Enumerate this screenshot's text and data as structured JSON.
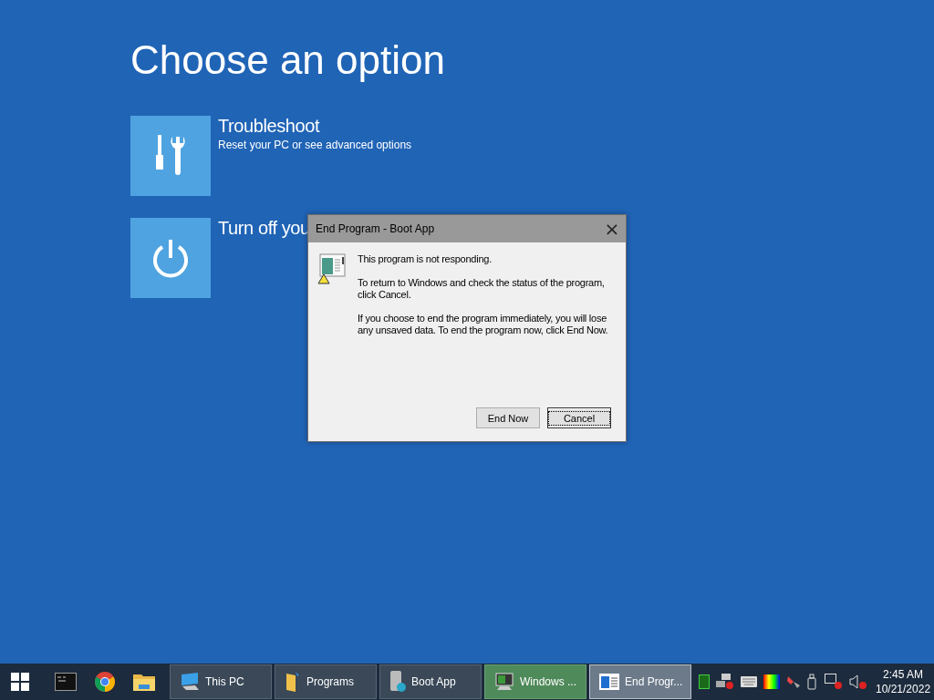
{
  "screen": {
    "title": "Choose an option",
    "options": [
      {
        "kind": "troubleshoot",
        "title": "Troubleshoot",
        "subtitle": "Reset your PC or see advanced options"
      },
      {
        "kind": "power",
        "title": "Turn off you"
      }
    ]
  },
  "dialog": {
    "title": "End Program - Boot App",
    "close": "×",
    "paragraphs": [
      "This program is not responding.",
      "To return to Windows and check the status of the program, click Cancel.",
      "If you choose to end the program immediately, you will lose any unsaved data. To end the program now, click End Now."
    ],
    "buttons": [
      {
        "label": "End Now",
        "default": false
      },
      {
        "label": "Cancel",
        "default": true
      }
    ]
  },
  "taskbar": {
    "tasks": [
      {
        "kind": "pc",
        "label": "This PC",
        "selected": false,
        "flashing": false
      },
      {
        "kind": "folder",
        "label": "Programs",
        "selected": false,
        "flashing": false
      },
      {
        "kind": "drive",
        "label": "Boot App",
        "selected": false,
        "flashing": false
      },
      {
        "kind": "monitor",
        "label": "Windows ...",
        "selected": false,
        "flashing": true
      },
      {
        "kind": "window",
        "label": "End Progr...",
        "selected": true,
        "flashing": false
      }
    ],
    "clock": {
      "time": "2:45 AM",
      "date": "10/21/2022"
    }
  }
}
